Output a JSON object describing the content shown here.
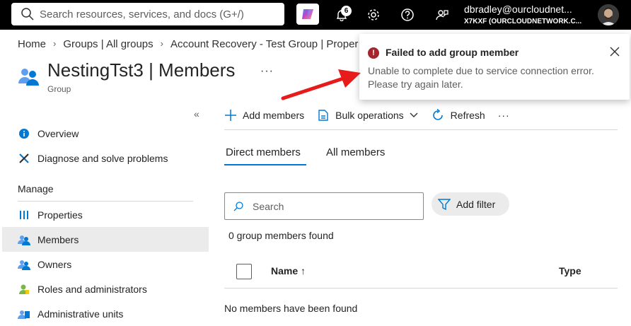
{
  "topbar": {
    "search_placeholder": "Search resources, services, and docs (G+/)",
    "notification_count": "6",
    "user_name": "dbradley@ourcloudnet...",
    "user_tenant": "X7KXF (OURCLOUDNETWORK.C..."
  },
  "breadcrumb": [
    "Home",
    "Groups | All groups",
    "Account Recovery - Test Group | Proper"
  ],
  "page": {
    "title": "NestingTst3 | Members",
    "subtitle": "Group",
    "more": "···"
  },
  "sidebar": {
    "collapse": "«",
    "items_top": [
      {
        "label": "Overview",
        "icon": "info-icon"
      },
      {
        "label": "Diagnose and solve problems",
        "icon": "wrench-icon"
      }
    ],
    "section_label": "Manage",
    "items_manage": [
      {
        "label": "Properties",
        "icon": "properties-icon"
      },
      {
        "label": "Members",
        "icon": "members-icon",
        "active": true
      },
      {
        "label": "Owners",
        "icon": "owners-icon"
      },
      {
        "label": "Roles and administrators",
        "icon": "roles-icon"
      },
      {
        "label": "Administrative units",
        "icon": "admin-units-icon"
      }
    ]
  },
  "toolbar": {
    "add_members": "Add members",
    "bulk_operations": "Bulk operations",
    "refresh": "Refresh",
    "more": "···"
  },
  "tabs": {
    "direct": "Direct members",
    "all": "All members"
  },
  "search": {
    "placeholder": "Search"
  },
  "filter": {
    "label": "Add filter"
  },
  "results": {
    "found": "0 group members found",
    "col_name": "Name ↑",
    "col_type": "Type",
    "empty": "No members have been found"
  },
  "toast": {
    "title": "Failed to add group member",
    "message": "Unable to complete due to service connection error. Please try again later.",
    "icon": "!"
  },
  "colors": {
    "accent": "#0078d4",
    "error": "#a4262c",
    "annotation_arrow": "#e81b1b"
  }
}
